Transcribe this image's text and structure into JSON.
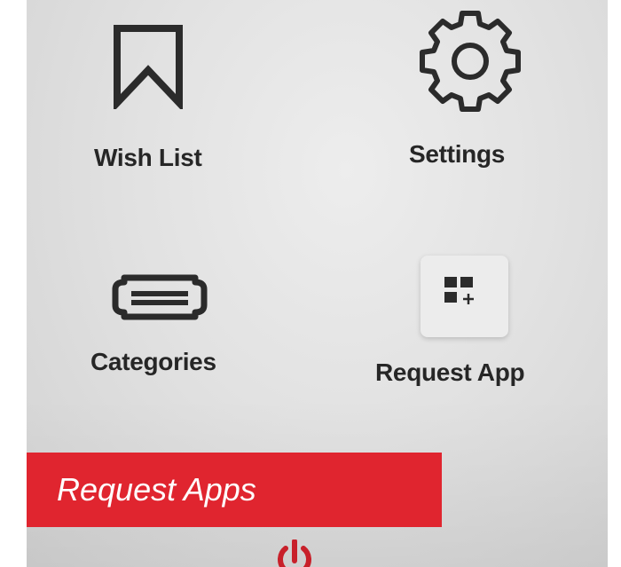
{
  "menu": {
    "wish_list": {
      "label": "Wish List",
      "icon": "bookmark-icon"
    },
    "settings": {
      "label": "Settings",
      "icon": "gear-icon"
    },
    "categories": {
      "label": "Categories",
      "icon": "categories-icon"
    },
    "request_app": {
      "label": "Request App",
      "icon": "grid-plus-icon"
    }
  },
  "banner": {
    "text": "Request Apps",
    "color": "#e0252f"
  },
  "power": {
    "icon": "power-icon",
    "color": "#c8202a"
  }
}
